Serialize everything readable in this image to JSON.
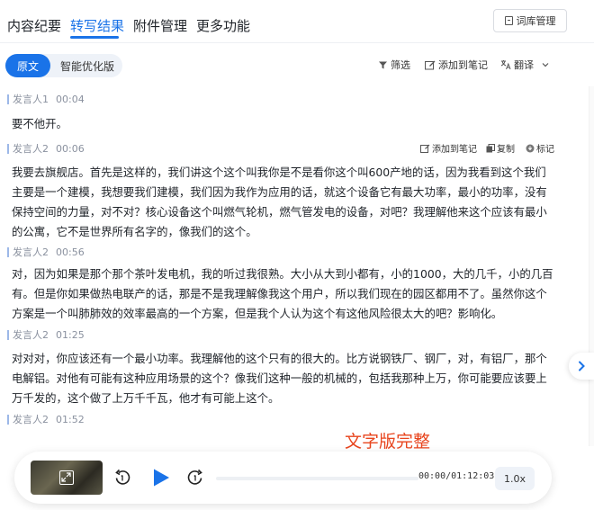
{
  "tabs": [
    {
      "label": "内容纪要"
    },
    {
      "label": "转写结果"
    },
    {
      "label": "附件管理"
    },
    {
      "label": "更多功能"
    }
  ],
  "lexicon_button": "词库管理",
  "toolbar": {
    "original_label": "原文",
    "optimized_label": "智能优化版",
    "filter_label": "筛选",
    "add_note_label": "添加到笔记",
    "translate_label": "翻译"
  },
  "segments": [
    {
      "speaker": "发言人1",
      "time": "00:04",
      "text": "要不他开。"
    },
    {
      "speaker": "发言人2",
      "time": "00:06",
      "text": "我要去旗舰店。首先是这样的，我们讲这个这个叫我你是不是看你这个叫600产地的话，因为我看到这个我们主要是一个建模，我想要我们建模，我们因为我作为应用的话，就这个设备它有最大功率，最小的功率，没有保持空间的力量，对不对？核心设备这个叫燃气轮机，燃气管发电的设备，对吧？我理解他来这个应该有最小的公寓，它不是世界所有名字的，像我们的这个。"
    },
    {
      "speaker": "发言人2",
      "time": "00:56",
      "text": "对，因为如果是那个那个茶叶发电机，我的听过我很熟。大小从大到小都有，小的1000，大的几千，小的几百有。但是你如果做热电联产的话，那是不是我理解像我这个用户，所以我们现在的园区都用不了。虽然你这个方案是一个叫肺肺效的效率最高的一个方案，但是我个人认为这个有这他风险很太大的吧？影响化。"
    },
    {
      "speaker": "发言人2",
      "time": "01:25",
      "text": "对对对，你应该还有一个最小功率。我理解他的这个只有的很大的。比方说钢铁厂、钢厂，对，有铝厂，那个电解铝。对他有可能有这种应用场景的这个？像我们这种一般的机械的，包括我那种上万，你可能要应该要上万千发的，这个做了上万千千瓦，他才有可能上这个。"
    },
    {
      "speaker": "发言人2",
      "time": "01:52",
      "text": ""
    }
  ],
  "segment_actions": {
    "add_note": "添加到笔记",
    "copy": "复制",
    "mark": "标记"
  },
  "watermark": "文字版完整",
  "player": {
    "rewind_icon": "rewind-icon",
    "play_icon": "play-icon",
    "forward_icon": "forward-icon",
    "time_display": "00:00/01:12:03",
    "speed": "1.0x",
    "progress": 0
  },
  "colors": {
    "accent": "#1a73e8",
    "watermark": "#e8451e"
  }
}
